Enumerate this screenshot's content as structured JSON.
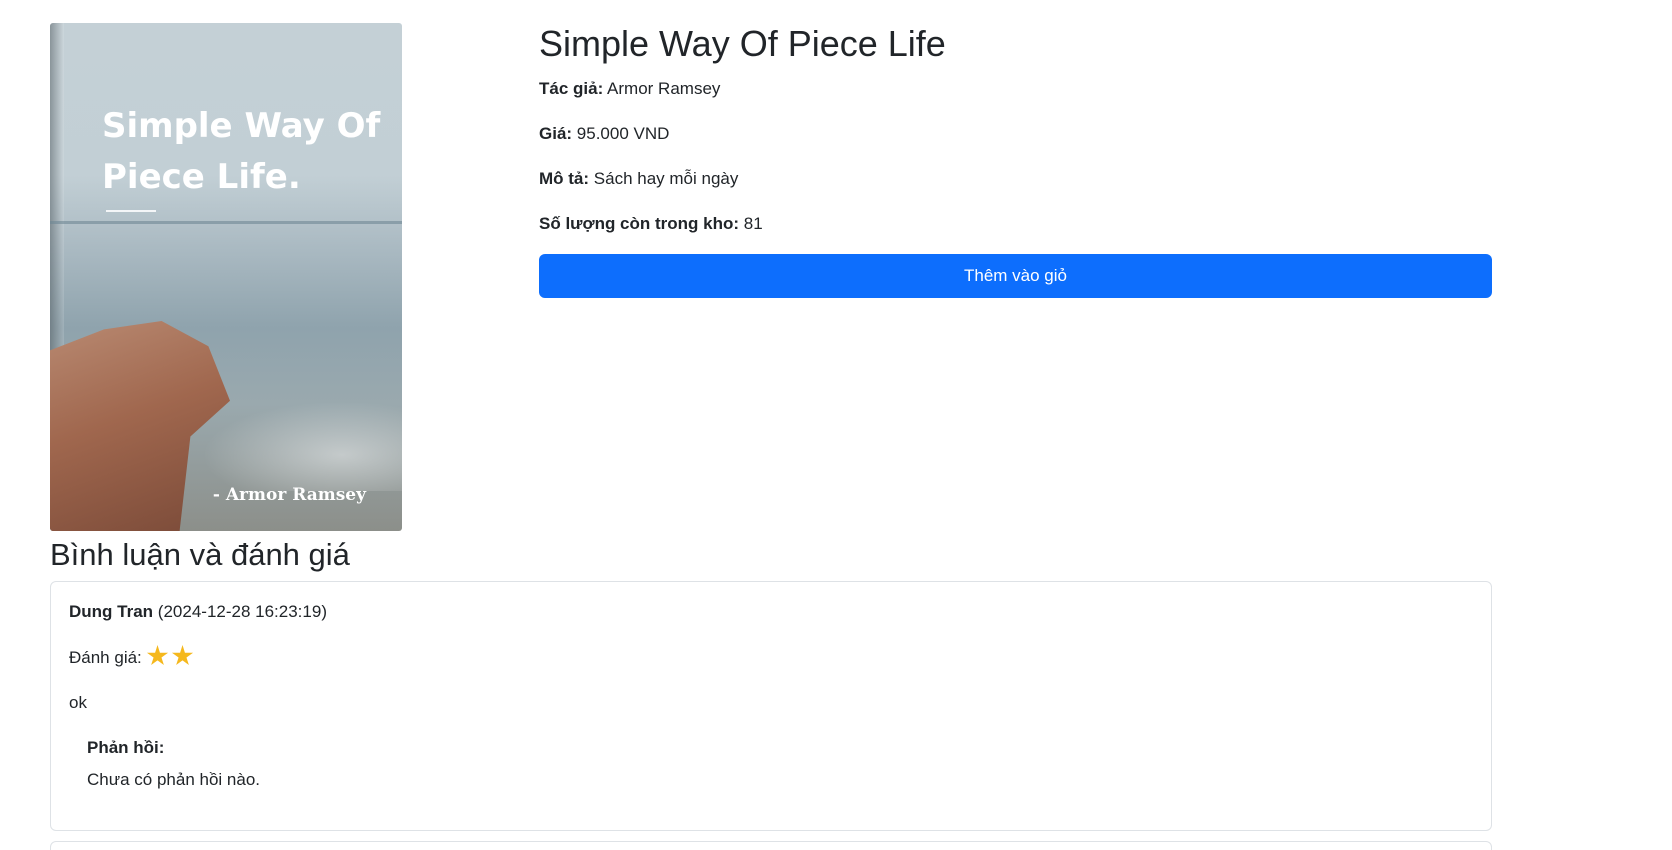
{
  "product": {
    "title": "Simple Way Of Piece Life",
    "cover": {
      "title_text": "Simple Way Of Piece Life.",
      "author_text": "- Armor Ramsey"
    },
    "author_label": "Tác giả:",
    "author": "Armor Ramsey",
    "price_label": "Giá:",
    "price": "95.000 VND",
    "description_label": "Mô tả:",
    "description": "Sách hay mỗi ngày",
    "stock_label": "Số lượng còn trong kho:",
    "stock": "81",
    "add_to_cart_label": "Thêm vào giỏ",
    "accent_color": "#0d6efd"
  },
  "reviews": {
    "heading": "Bình luận và đánh giá",
    "items": [
      {
        "user": "Dung Tran",
        "timestamp": "(2024-12-28 16:23:19)",
        "rating_label": "Đánh giá:",
        "rating": 2,
        "star_icon": "star-icon",
        "comment": "ok",
        "reply_label": "Phản hồi:",
        "reply_text": "Chưa có phản hồi nào."
      }
    ]
  }
}
